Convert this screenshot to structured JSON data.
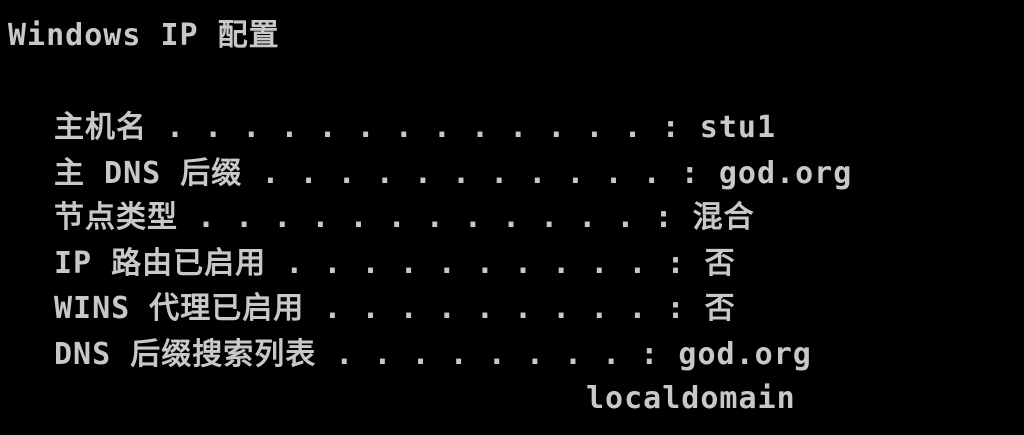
{
  "console": {
    "title": "Windows IP 配置",
    "rows": [
      "主机名 . . . . . . . . . . . . . : stu1",
      "主 DNS 后缀 . . . . . . . . . . . : god.org",
      "节点类型 . . . . . . . . . . . . : 混合",
      "IP 路由已启用 . . . . . . . . . . : 否",
      "WINS 代理已启用 . . . . . . . . . : 否",
      "DNS 后缀搜索列表 . . . . . . . . : god.org"
    ],
    "continuation": "localdomain"
  }
}
